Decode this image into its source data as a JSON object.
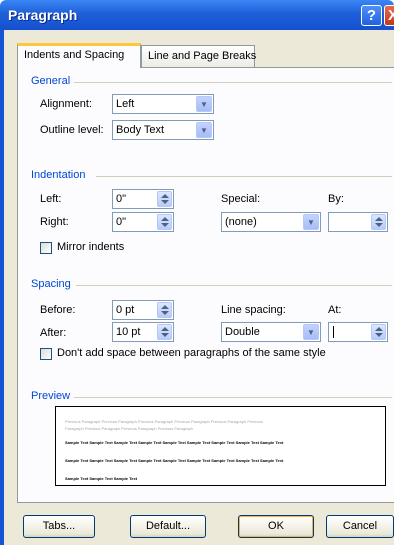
{
  "window": {
    "title": "Paragraph",
    "help_glyph": "?",
    "close_glyph": "X"
  },
  "tabs": [
    {
      "label": "Indents and Spacing"
    },
    {
      "label": "Line and Page Breaks"
    }
  ],
  "general": {
    "title": "General",
    "alignment_label": "Alignment:",
    "alignment_value": "Left",
    "outline_label": "Outline level:",
    "outline_value": "Body Text"
  },
  "indentation": {
    "title": "Indentation",
    "left_label": "Left:",
    "left_value": "0\"",
    "right_label": "Right:",
    "right_value": "0\"",
    "special_label": "Special:",
    "special_value": "(none)",
    "by_label": "By:",
    "by_value": "",
    "mirror_label": "Mirror indents",
    "mirror_checked": false
  },
  "spacing": {
    "title": "Spacing",
    "before_label": "Before:",
    "before_value": "0 pt",
    "after_label": "After:",
    "after_value": "10 pt",
    "line_spacing_label": "Line spacing:",
    "line_spacing_value": "Double",
    "at_label": "At:",
    "at_value": "",
    "dont_add_label": "Don't add space between paragraphs of the same style",
    "dont_add_checked": false
  },
  "preview": {
    "title": "Preview",
    "previous_line_1": "Previous Paragraph Previous Paragraph Previous Paragraph Previous Paragraph Previous Paragraph Previous",
    "previous_line_2": "Paragraph Previous Paragraph Previous Paragraph Previous Paragraph",
    "sample_line_1": "Sample Text Sample Text Sample Text Sample Text Sample Text Sample Text Sample Text Sample Text Sample Text",
    "sample_line_2": "Sample Text Sample Text Sample Text Sample Text Sample Text Sample Text Sample Text Sample Text Sample Text",
    "sample_line_3": "Sample Text Sample Text Sample Text"
  },
  "buttons": {
    "tabs": "Tabs...",
    "default": "Default...",
    "ok": "OK",
    "cancel": "Cancel"
  },
  "colors": {
    "titlebar": "#1f5fd9",
    "section_title": "#0046d5",
    "dialog_bg": "#ece9d8",
    "active_tab_accent": "#ffc83c"
  }
}
